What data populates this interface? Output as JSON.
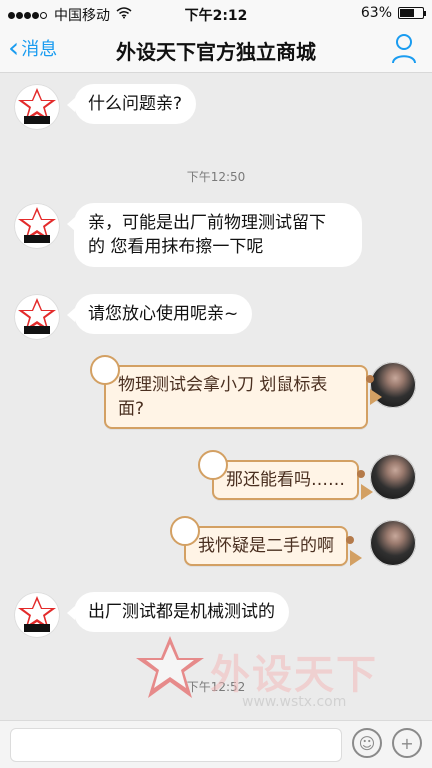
{
  "status_bar": {
    "carrier": "中国移动",
    "time": "下午2:12",
    "battery_text": "63%",
    "battery_level": 0.63
  },
  "nav": {
    "back_label": "消息",
    "title": "外设天下官方独立商城"
  },
  "messages": [
    {
      "side": "left",
      "text": "什么问题亲?"
    },
    {
      "timestamp": "下午12:50"
    },
    {
      "side": "left",
      "text_lines": [
        "亲，可能是出厂前物理测试留下",
        "的 您看用抹布擦一下呢"
      ]
    },
    {
      "side": "left",
      "text": "请您放心使用呢亲~"
    },
    {
      "side": "right",
      "text_lines": [
        "物理测试会拿小刀 划鼠标表",
        "面?"
      ]
    },
    {
      "side": "right",
      "text": "那还能看吗……"
    },
    {
      "side": "right",
      "text": "我怀疑是二手的啊"
    },
    {
      "side": "left",
      "text": "出厂测试都是机械测试的"
    },
    {
      "timestamp": "下午12:52"
    }
  ],
  "watermark": {
    "text": "外设天下",
    "url": "www.wstx.com"
  },
  "colors": {
    "accent": "#1a9cf0",
    "bubble_left": "#ffffff",
    "bubble_right_bg": "#fff4e6",
    "bubble_right_border": "#d3a063",
    "background": "#ebebeb"
  },
  "icons": {
    "profile": "person-icon",
    "emoji": "smiley-icon",
    "plus": "plus-icon",
    "wifi": "wifi-icon"
  }
}
